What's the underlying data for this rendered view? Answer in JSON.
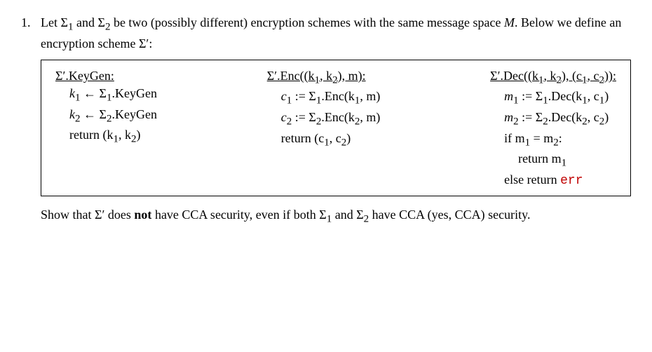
{
  "problem": {
    "number": "1.",
    "intro_a": "Let Σ",
    "intro_b": " and Σ",
    "intro_c": " be two (possibly different) encryption schemes with the same message space ",
    "intro_d": ". Below we define an encryption scheme Σ′:",
    "sub1": "1",
    "sub2": "2",
    "calM": "M"
  },
  "keygen": {
    "header": "Σ′.KeyGen:",
    "l1a": "k",
    "l1b": " ← Σ",
    "l1c": ".KeyGen",
    "l2a": "k",
    "l2b": " ← Σ",
    "l2c": ".KeyGen",
    "ret": "return (k",
    "retmid": ", k",
    "retend": ")"
  },
  "enc": {
    "header_a": "Σ′.Enc((k",
    "header_b": ", k",
    "header_c": "), m):",
    "l1a": "c",
    "l1b": " := Σ",
    "l1c": ".Enc(k",
    "l1d": ", m)",
    "l2a": "c",
    "l2b": " := Σ",
    "l2c": ".Enc(k",
    "l2d": ", m)",
    "ret": "return (c",
    "retmid": ", c",
    "retend": ")"
  },
  "dec": {
    "header_a": "Σ′.Dec((k",
    "header_b": ", k",
    "header_c": "), (c",
    "header_d": ", c",
    "header_e": ")):",
    "l1a": "m",
    "l1b": " := Σ",
    "l1c": ".Dec(k",
    "l1d": ", c",
    "l1e": ")",
    "l2a": "m",
    "l2b": " := Σ",
    "l2c": ".Dec(k",
    "l2d": ", c",
    "l2e": ")",
    "if_a": "if m",
    "if_b": " = m",
    "if_c": ":",
    "ret1": "return m",
    "else": "else return ",
    "err": "err"
  },
  "final": {
    "a": "Show that Σ′ does ",
    "not": "not",
    "b": " have CCA security, even if both Σ",
    "c": " and Σ",
    "d": " have CCA (yes, CCA) security."
  }
}
